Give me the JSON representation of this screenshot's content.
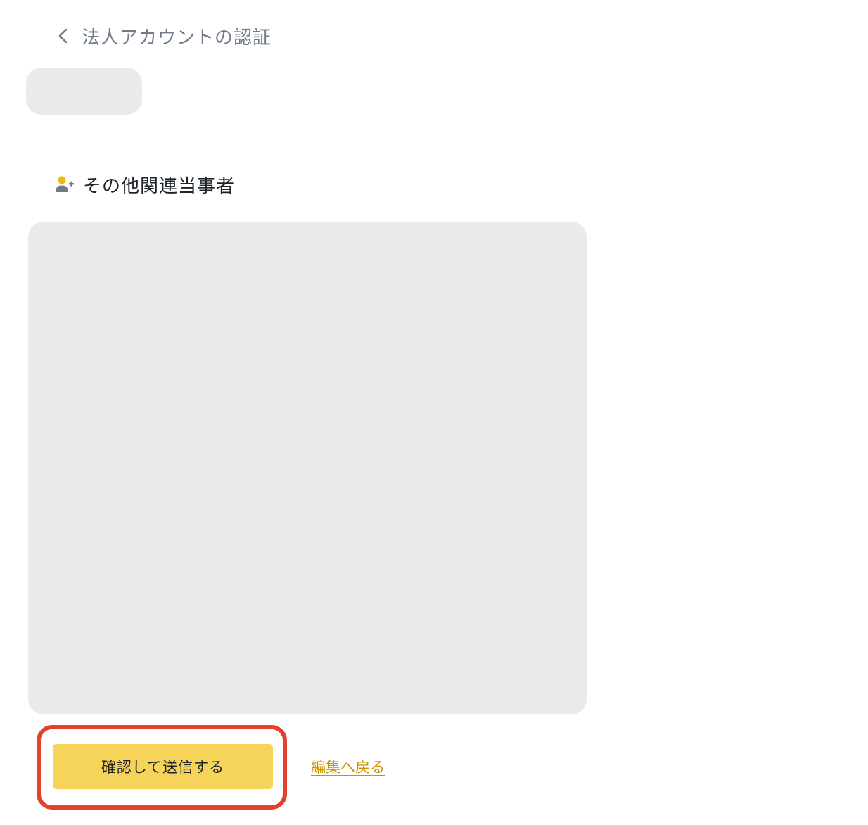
{
  "header": {
    "back_icon": "chevron-left-icon",
    "title": "法人アカウントの認証"
  },
  "section": {
    "icon": "person-add-icon",
    "title": "その他関連当事者"
  },
  "actions": {
    "submit_label": "確認して送信する",
    "back_to_edit_label": "編集へ戻る"
  },
  "colors": {
    "accent_yellow": "#f6d45a",
    "link_gold": "#c99400",
    "highlight_red": "#e3412d",
    "skeleton_gray": "#eaeaea",
    "muted_text": "#707a8a"
  }
}
